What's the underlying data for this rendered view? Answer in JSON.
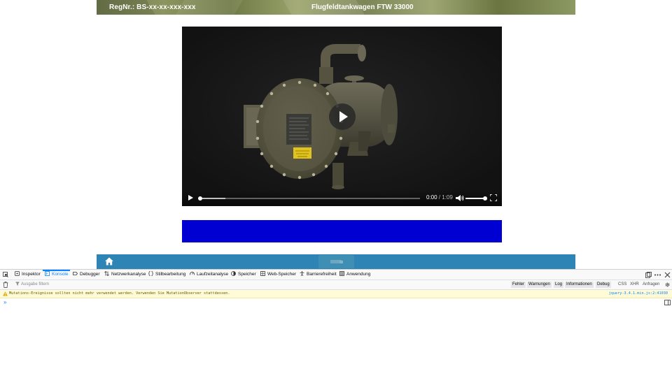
{
  "header": {
    "regnr": "RegNr.: BS-xx-xx-xxx-xxx",
    "vehicle": "Flugfeldtankwagen FTW 33000"
  },
  "video": {
    "current_time": "0:00",
    "separator": " / ",
    "duration": "1:09",
    "progress": 0,
    "volume": 1.0
  },
  "colors": {
    "blue_box": "#0000d2",
    "footer_bar": "#2f84b6",
    "devtools_accent": "#0a84ff"
  },
  "devtools": {
    "tabs": [
      {
        "label": "Inspektor",
        "icon": "inspector-icon"
      },
      {
        "label": "Konsole",
        "icon": "console-icon",
        "active": true
      },
      {
        "label": "Debugger",
        "icon": "debugger-icon"
      },
      {
        "label": "Netzwerkanalyse",
        "icon": "network-icon"
      },
      {
        "label": "Stilbearbeitung",
        "icon": "style-editor-icon"
      },
      {
        "label": "Laufzeitanalyse",
        "icon": "performance-icon"
      },
      {
        "label": "Speicher",
        "icon": "memory-icon"
      },
      {
        "label": "Web-Speicher",
        "icon": "storage-icon"
      },
      {
        "label": "Barrierefreiheit",
        "icon": "accessibility-icon"
      },
      {
        "label": "Anwendung",
        "icon": "application-icon"
      }
    ],
    "filter_placeholder": "Ausgabe filtern",
    "levels": [
      "Fehler",
      "Warnungen",
      "Log",
      "Informationen",
      "Debug"
    ],
    "types": [
      "CSS",
      "XHR",
      "Anfragen"
    ],
    "warning": {
      "text": "Mutations-Ereignisse sollten nicht mehr verwendet werden. Verwenden Sie MutationObserver stattdessen.",
      "source": "jquery-3.4.1.min.js:2:41030"
    },
    "prompt": "»"
  }
}
